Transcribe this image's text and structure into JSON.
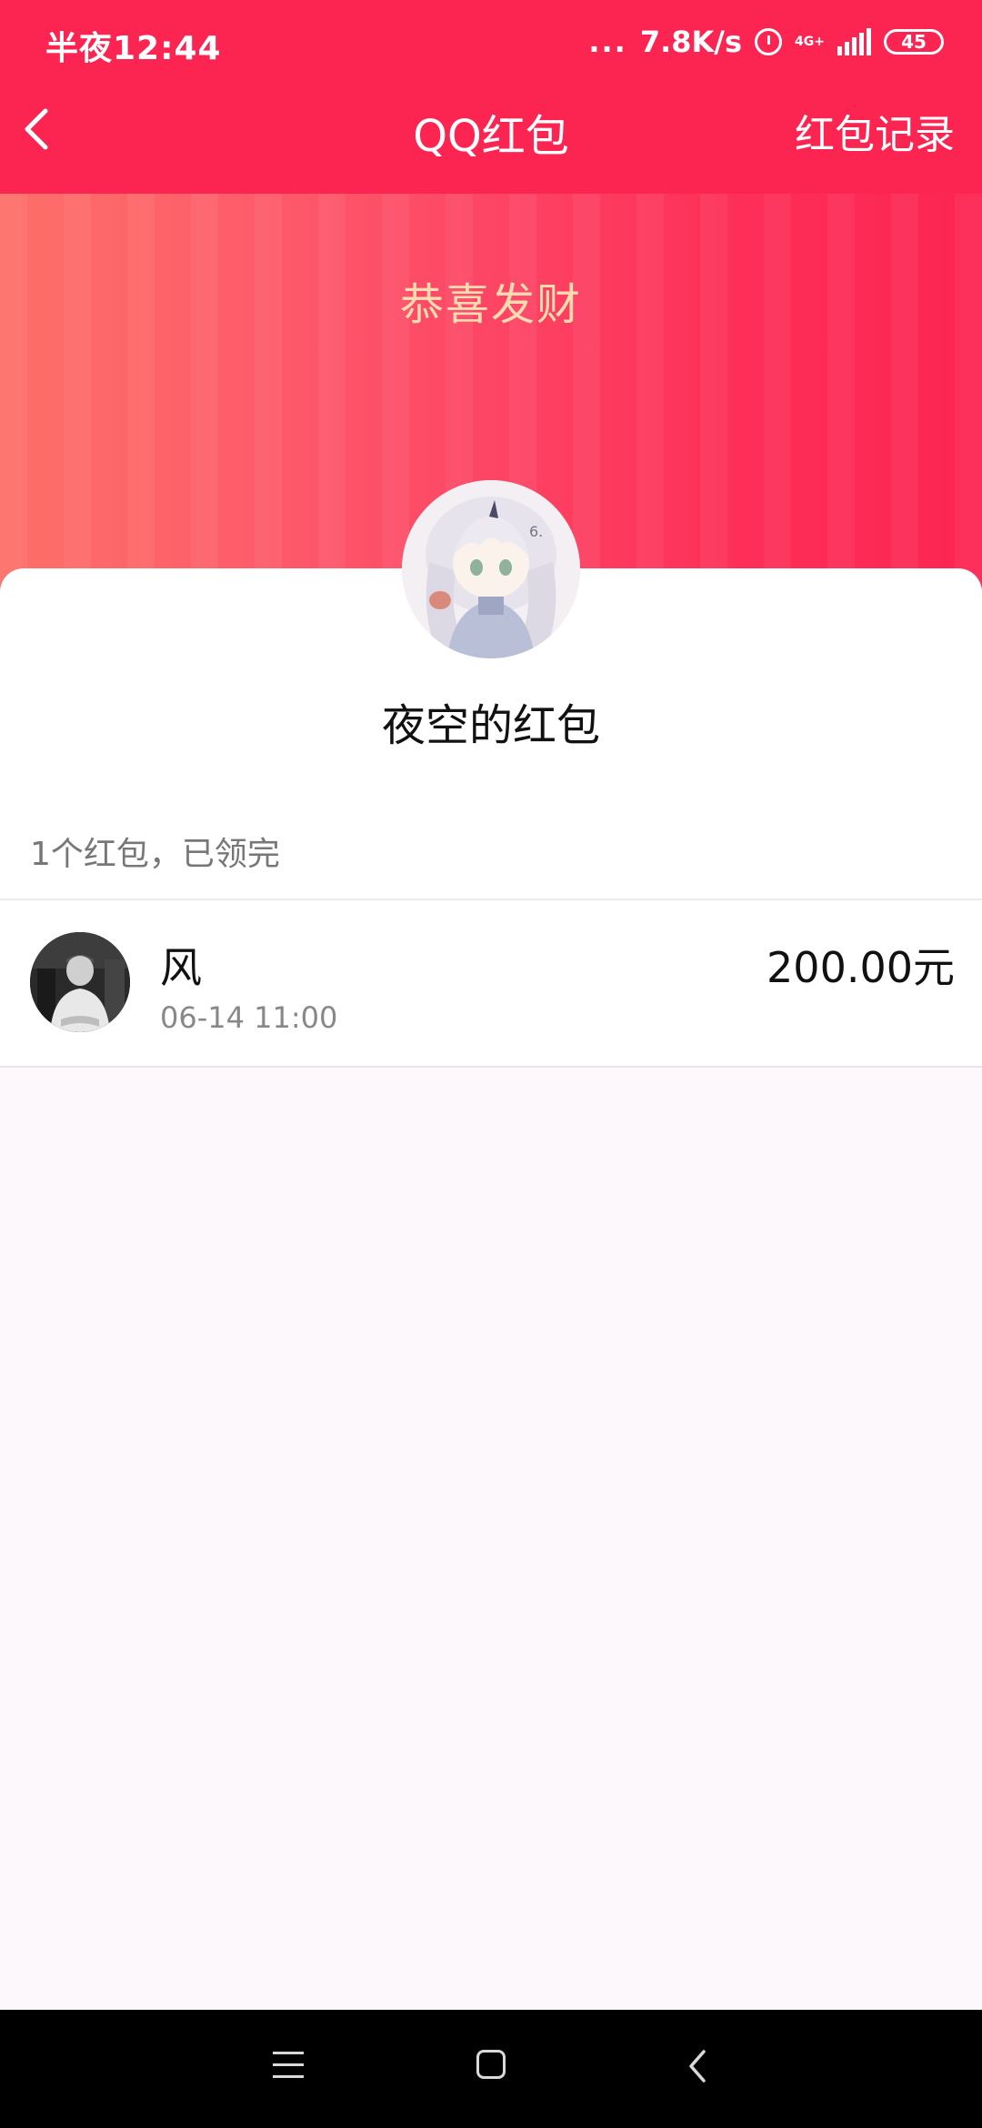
{
  "status_bar": {
    "time": "半夜12:44",
    "dots": "...",
    "net_speed": "7.8K/s",
    "network_type": "4G+",
    "battery": "45"
  },
  "header": {
    "title": "QQ红包",
    "action_label": "红包记录"
  },
  "banner": {
    "greeting": "恭喜发财"
  },
  "packet": {
    "sender_name": "夜空的红包",
    "summary": "1个红包，已领完"
  },
  "receivers": [
    {
      "name": "风",
      "time": "06-14 11:00",
      "amount": "200.00元"
    }
  ],
  "colors": {
    "header_red": "#fc2551",
    "banner_text": "#f9dcb0"
  }
}
